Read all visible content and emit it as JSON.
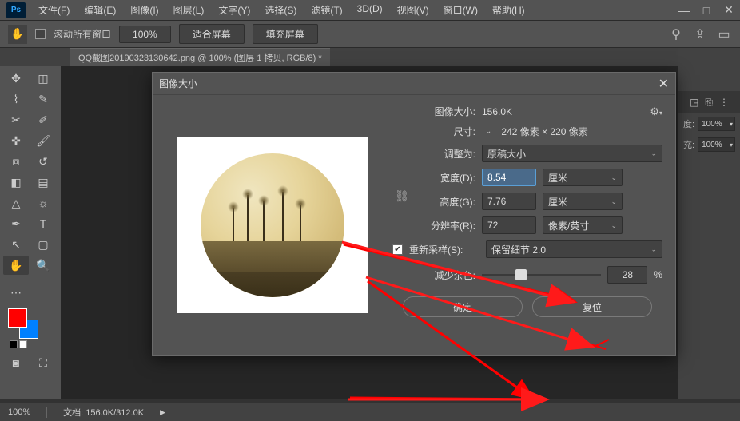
{
  "app_logo": "Ps",
  "menu": [
    "文件(F)",
    "编辑(E)",
    "图像(I)",
    "图层(L)",
    "文字(Y)",
    "选择(S)",
    "滤镜(T)",
    "3D(D)",
    "视图(V)",
    "窗口(W)",
    "帮助(H)"
  ],
  "options": {
    "scroll_all": "滚动所有窗口",
    "zoom": "100%",
    "fit_screen": "适合屏幕",
    "fill_screen": "填充屏幕"
  },
  "doc_tab": "QQ截图20190323130642.png @ 100% (图层 1 拷贝, RGB/8) *",
  "status": {
    "zoom": "100%",
    "doc_info": "文档: 156.0K/312.0K"
  },
  "dialog": {
    "title": "图像大小",
    "size_label": "图像大小:",
    "size_value": "156.0K",
    "dim_label": "尺寸:",
    "dim_value": "242 像素 × 220 像素",
    "fitfor_label": "调整为:",
    "fitfor_value": "原稿大小",
    "width_label": "宽度(D):",
    "width_value": "8.54",
    "height_label": "高度(G):",
    "height_value": "7.76",
    "wh_unit": "厘米",
    "res_label": "分辨率(R):",
    "res_value": "72",
    "res_unit": "像素/英寸",
    "resample_label": "重新采样(S):",
    "resample_value": "保留细节 2.0",
    "noise_label": "减少杂色:",
    "noise_value": "28",
    "noise_unit": "%",
    "ok": "确定",
    "cancel": "复位"
  },
  "side": {
    "pct1": "100%",
    "pct2": "100%",
    "lbl1": "度:",
    "lbl2": "充:"
  }
}
